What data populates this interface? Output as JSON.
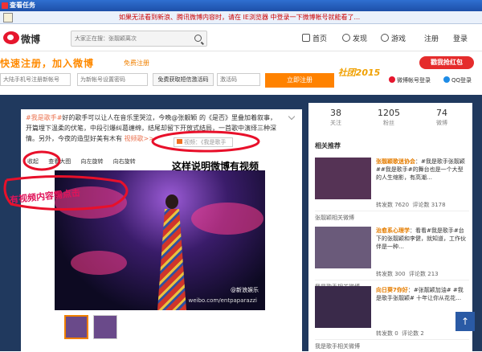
{
  "window": {
    "title": "查看任务"
  },
  "notice": {
    "text": "如果无法看到新浪、腾讯微博内容时，请在 IE浏览器 中登录一下微博帐号就能看了..."
  },
  "header": {
    "logo": "微博",
    "search_placeholder": "大家正在搜：张靓颖离次",
    "nav": [
      {
        "label": "首页",
        "icon": "home-icon"
      },
      {
        "label": "发现",
        "icon": "discover-icon"
      },
      {
        "label": "游戏",
        "icon": "game-icon"
      },
      {
        "label": "注册"
      },
      {
        "label": "登录"
      }
    ]
  },
  "register": {
    "slogan": "快速注册，加入微博",
    "free_label": "免费注册",
    "phone_placeholder": "大陆手机号注册新帐号",
    "password_placeholder": "为新帐号设置密码",
    "sms_button": "免费获取短信激活码",
    "code_placeholder": "激活码",
    "submit_button": "立即注册",
    "promo": "社团2015",
    "red_packet": "戳我抢红包",
    "weibo_login": "微博帐号登录",
    "qq_login": "QQ登录"
  },
  "post": {
    "tag": "#我是歌手#",
    "text": "好的歌手可以让人在音乐里哭泣，今晚@张靓颖 的《是否》里叠加着叙事，开篇埋下温柔的伏笔，中段引爆纠葛缠绵，结尾却留下开放式结局，一首歌中演绎三种深情。另外，今夜的造型好美有木有",
    "video_link": "视频歌>>",
    "video_tag": "视频：《我是歌手",
    "actions": [
      "收起",
      "查看大图",
      "向左旋转",
      "向右旋转"
    ],
    "watermark": "@新浪娱乐",
    "watermark2": "weibo.com/entpaparazzi"
  },
  "annotations": {
    "note1": "这样说明微博有视频",
    "note2": "有视频内容需点击"
  },
  "profile_stats": [
    {
      "value": "38",
      "label": "关注"
    },
    {
      "value": "1205",
      "label": "粉丝"
    },
    {
      "value": "74",
      "label": "微博"
    }
  ],
  "related": {
    "title": "相关推荐",
    "items": [
      {
        "name": "张靓颖歌迷协会",
        "desc": "：#我是歌手张靓颖##我是歌手#的舞台也是一个大型的人生缩影，有高潮…",
        "reposts": "转发数 7620",
        "comments": "评论数 3178",
        "caption": "张靓颖相关微博"
      },
      {
        "name": "治愈系心理学",
        "desc": "：看看#我是歌手#台下的张靓颖和李健，就知道，工作伙伴是一种…",
        "reposts": "转发数 300",
        "comments": "评论数 213",
        "caption": "我是歌手相关微博"
      },
      {
        "name": "向日葵7你好",
        "desc": "：#张靓颖加油# #我是歌手张靓颖# 十年让你从花花…",
        "reposts": "转发数 0",
        "comments": "评论数 2",
        "caption": "我是歌手相关微博"
      }
    ]
  }
}
